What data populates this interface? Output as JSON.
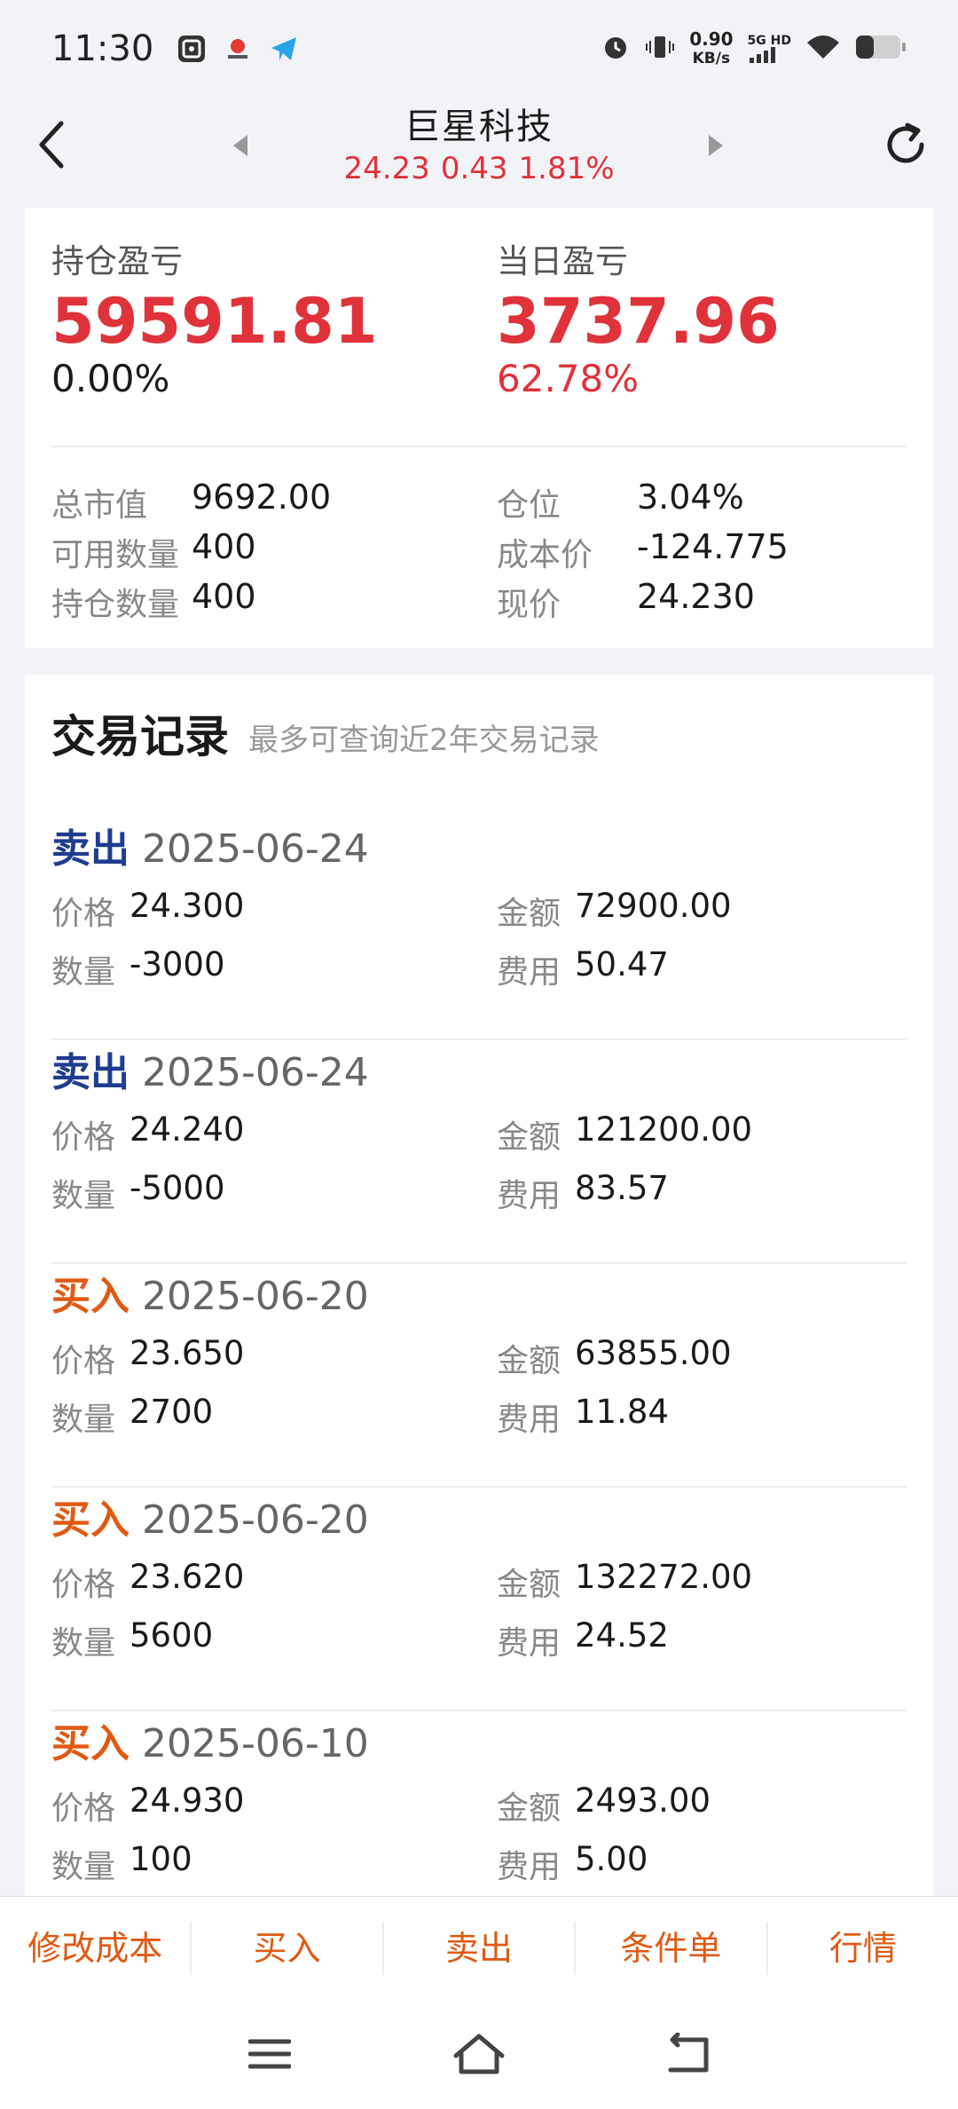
{
  "status_bar": {
    "time": "11:30",
    "net_speed_value": "0.90",
    "net_speed_unit": "KB/s",
    "signal_label": "5G HD",
    "app_icons": [
      "scan-app-icon",
      "finance-app-icon",
      "telegram-icon"
    ],
    "right_icons": [
      "alarm-icon",
      "vibrate-icon",
      "signal-icon",
      "wifi-icon",
      "battery-icon"
    ]
  },
  "header": {
    "stock_name": "巨星科技",
    "price": "24.23",
    "change": "0.43",
    "change_pct": "1.81%"
  },
  "summary": {
    "holding_pl_label": "持仓盈亏",
    "holding_pl_value": "59591.81",
    "holding_pl_pct": "0.00%",
    "daily_pl_label": "当日盈亏",
    "daily_pl_value": "3737.96",
    "daily_pl_pct": "62.78%",
    "stats": {
      "market_value_label": "总市值",
      "market_value": "9692.00",
      "available_qty_label": "可用数量",
      "available_qty": "400",
      "holding_qty_label": "持仓数量",
      "holding_qty": "400",
      "position_label": "仓位",
      "position": "3.04%",
      "cost_price_label": "成本价",
      "cost_price": "-124.775",
      "current_price_label": "现价",
      "current_price": "24.230"
    }
  },
  "trades": {
    "title": "交易记录",
    "subtitle": "最多可查询近2年交易记录",
    "labels": {
      "price": "价格",
      "amount": "金额",
      "quantity": "数量",
      "fee": "费用"
    },
    "records": [
      {
        "type": "卖出",
        "date": "2025-06-24",
        "price": "24.300",
        "amount": "72900.00",
        "quantity": "-3000",
        "fee": "50.47"
      },
      {
        "type": "卖出",
        "date": "2025-06-24",
        "price": "24.240",
        "amount": "121200.00",
        "quantity": "-5000",
        "fee": "83.57"
      },
      {
        "type": "买入",
        "date": "2025-06-20",
        "price": "23.650",
        "amount": "63855.00",
        "quantity": "2700",
        "fee": "11.84"
      },
      {
        "type": "买入",
        "date": "2025-06-20",
        "price": "23.620",
        "amount": "132272.00",
        "quantity": "5600",
        "fee": "24.52"
      },
      {
        "type": "买入",
        "date": "2025-06-10",
        "price": "24.930",
        "amount": "2493.00",
        "quantity": "100",
        "fee": "5.00"
      }
    ]
  },
  "actions": {
    "modify_cost": "修改成本",
    "buy": "买入",
    "sell": "卖出",
    "conditional_order": "条件单",
    "market": "行情"
  },
  "colors": {
    "up_red": "#e0323a",
    "sell_blue": "#1f3d8f",
    "buy_orange": "#e05a13"
  }
}
